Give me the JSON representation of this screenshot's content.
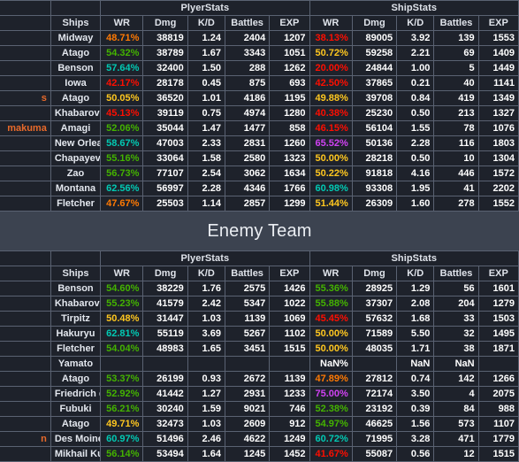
{
  "banner": {
    "enemy_team_title": "Enemy Team"
  },
  "group_headers": {
    "player_stats": "PlyerStats",
    "ship_stats": "ShipStats"
  },
  "columns": {
    "name": "",
    "ships": "Ships",
    "player": {
      "wr": "WR",
      "dmg": "Dmg",
      "kd": "K/D",
      "battles": "Battles",
      "exp": "EXP"
    },
    "ship": {
      "wr": "WR",
      "dmg": "Dmg",
      "kd": "K/D",
      "battles": "Battles",
      "exp": "EXP"
    }
  },
  "colors": {
    "red": "#fe0e00",
    "orange": "#fe7903",
    "yellow": "#ffc71f",
    "green": "#44b300",
    "teal": "#02c9b3",
    "purple": "#d042f3",
    "player_name": "#e96a2a",
    "banner_bg": "#3c4350",
    "table_bg": "#1e222b",
    "page_bg": "#2c313c",
    "grid": "#5a6272"
  },
  "friendly_team": {
    "rows": [
      {
        "name": "",
        "ship": "Midway",
        "p_wr": "48.71%",
        "p_wr_c": "wr-orange",
        "p_dmg": "38819",
        "p_kd": "1.24",
        "p_bat": "2404",
        "p_exp": "1207",
        "s_wr": "38.13%",
        "s_wr_c": "wr-red",
        "s_dmg": "89005",
        "s_kd": "3.92",
        "s_bat": "139",
        "s_exp": "1553"
      },
      {
        "name": "",
        "ship": "Atago",
        "p_wr": "54.32%",
        "p_wr_c": "wr-green",
        "p_dmg": "38789",
        "p_kd": "1.67",
        "p_bat": "3343",
        "p_exp": "1051",
        "s_wr": "50.72%",
        "s_wr_c": "wr-yellow",
        "s_dmg": "59258",
        "s_kd": "2.21",
        "s_bat": "69",
        "s_exp": "1409"
      },
      {
        "name": "",
        "ship": "Benson",
        "p_wr": "57.64%",
        "p_wr_c": "wr-teal",
        "p_dmg": "32400",
        "p_kd": "1.50",
        "p_bat": "288",
        "p_exp": "1262",
        "s_wr": "20.00%",
        "s_wr_c": "wr-red",
        "s_dmg": "24844",
        "s_kd": "1.00",
        "s_bat": "5",
        "s_exp": "1449"
      },
      {
        "name": "",
        "ship": "Iowa",
        "p_wr": "42.17%",
        "p_wr_c": "wr-red",
        "p_dmg": "28178",
        "p_kd": "0.45",
        "p_bat": "875",
        "p_exp": "693",
        "s_wr": "42.50%",
        "s_wr_c": "wr-red",
        "s_dmg": "37865",
        "s_kd": "0.21",
        "s_bat": "40",
        "s_exp": "1141"
      },
      {
        "name": "s",
        "ship": "Atago",
        "p_wr": "50.05%",
        "p_wr_c": "wr-yellow",
        "p_dmg": "36520",
        "p_kd": "1.01",
        "p_bat": "4186",
        "p_exp": "1195",
        "s_wr": "49.88%",
        "s_wr_c": "wr-yellow",
        "s_dmg": "39708",
        "s_kd": "0.84",
        "s_bat": "419",
        "s_exp": "1349"
      },
      {
        "name": "",
        "ship": "Khabarovsk",
        "p_wr": "45.13%",
        "p_wr_c": "wr-red",
        "p_dmg": "39119",
        "p_kd": "0.75",
        "p_bat": "4974",
        "p_exp": "1280",
        "s_wr": "40.38%",
        "s_wr_c": "wr-red",
        "s_dmg": "25230",
        "s_kd": "0.50",
        "s_bat": "213",
        "s_exp": "1327"
      },
      {
        "name": "makuma",
        "ship": "Amagi",
        "p_wr": "52.06%",
        "p_wr_c": "wr-green",
        "p_dmg": "35044",
        "p_kd": "1.47",
        "p_bat": "1477",
        "p_exp": "858",
        "s_wr": "46.15%",
        "s_wr_c": "wr-red",
        "s_dmg": "56104",
        "s_kd": "1.55",
        "s_bat": "78",
        "s_exp": "1076"
      },
      {
        "name": "",
        "ship": "New Orleans",
        "p_wr": "58.67%",
        "p_wr_c": "wr-teal",
        "p_dmg": "47003",
        "p_kd": "2.33",
        "p_bat": "2831",
        "p_exp": "1260",
        "s_wr": "65.52%",
        "s_wr_c": "wr-purple",
        "s_dmg": "50136",
        "s_kd": "2.28",
        "s_bat": "116",
        "s_exp": "1803"
      },
      {
        "name": "",
        "ship": "Chapayev",
        "p_wr": "55.16%",
        "p_wr_c": "wr-green",
        "p_dmg": "33064",
        "p_kd": "1.58",
        "p_bat": "2580",
        "p_exp": "1323",
        "s_wr": "50.00%",
        "s_wr_c": "wr-yellow",
        "s_dmg": "28218",
        "s_kd": "0.50",
        "s_bat": "10",
        "s_exp": "1304"
      },
      {
        "name": "",
        "ship": "Zao",
        "p_wr": "56.73%",
        "p_wr_c": "wr-green",
        "p_dmg": "77107",
        "p_kd": "2.54",
        "p_bat": "3062",
        "p_exp": "1634",
        "s_wr": "50.22%",
        "s_wr_c": "wr-yellow",
        "s_dmg": "91818",
        "s_kd": "4.16",
        "s_bat": "446",
        "s_exp": "1572"
      },
      {
        "name": "",
        "ship": "Montana",
        "p_wr": "62.56%",
        "p_wr_c": "wr-teal",
        "p_dmg": "56997",
        "p_kd": "2.28",
        "p_bat": "4346",
        "p_exp": "1766",
        "s_wr": "60.98%",
        "s_wr_c": "wr-teal",
        "s_dmg": "93308",
        "s_kd": "1.95",
        "s_bat": "41",
        "s_exp": "2202"
      },
      {
        "name": "",
        "ship": "Fletcher",
        "p_wr": "47.67%",
        "p_wr_c": "wr-orange",
        "p_dmg": "25503",
        "p_kd": "1.14",
        "p_bat": "2857",
        "p_exp": "1299",
        "s_wr": "51.44%",
        "s_wr_c": "wr-yellow",
        "s_dmg": "26309",
        "s_kd": "1.60",
        "s_bat": "278",
        "s_exp": "1552"
      }
    ]
  },
  "enemy_team": {
    "rows": [
      {
        "name": "",
        "ship": "Benson",
        "p_wr": "54.60%",
        "p_wr_c": "wr-green",
        "p_dmg": "38229",
        "p_kd": "1.76",
        "p_bat": "2575",
        "p_exp": "1426",
        "s_wr": "55.36%",
        "s_wr_c": "wr-green",
        "s_dmg": "28925",
        "s_kd": "1.29",
        "s_bat": "56",
        "s_exp": "1601"
      },
      {
        "name": "",
        "ship": "Khabarovsk",
        "p_wr": "55.23%",
        "p_wr_c": "wr-green",
        "p_dmg": "41579",
        "p_kd": "2.42",
        "p_bat": "5347",
        "p_exp": "1022",
        "s_wr": "55.88%",
        "s_wr_c": "wr-green",
        "s_dmg": "37307",
        "s_kd": "2.08",
        "s_bat": "204",
        "s_exp": "1279"
      },
      {
        "name": "",
        "ship": "Tirpitz",
        "p_wr": "50.48%",
        "p_wr_c": "wr-yellow",
        "p_dmg": "31447",
        "p_kd": "1.03",
        "p_bat": "1139",
        "p_exp": "1069",
        "s_wr": "45.45%",
        "s_wr_c": "wr-red",
        "s_dmg": "57632",
        "s_kd": "1.68",
        "s_bat": "33",
        "s_exp": "1503"
      },
      {
        "name": "",
        "ship": "Hakuryu",
        "p_wr": "62.81%",
        "p_wr_c": "wr-teal",
        "p_dmg": "55119",
        "p_kd": "3.69",
        "p_bat": "5267",
        "p_exp": "1102",
        "s_wr": "50.00%",
        "s_wr_c": "wr-yellow",
        "s_dmg": "71589",
        "s_kd": "5.50",
        "s_bat": "32",
        "s_exp": "1495"
      },
      {
        "name": "",
        "ship": "Fletcher",
        "p_wr": "54.04%",
        "p_wr_c": "wr-green",
        "p_dmg": "48983",
        "p_kd": "1.65",
        "p_bat": "3451",
        "p_exp": "1515",
        "s_wr": "50.00%",
        "s_wr_c": "wr-yellow",
        "s_dmg": "48035",
        "s_kd": "1.71",
        "s_bat": "38",
        "s_exp": "1871"
      },
      {
        "name": "",
        "ship": "Yamato",
        "p_wr": "",
        "p_wr_c": "wr-nan",
        "p_dmg": "",
        "p_kd": "",
        "p_bat": "",
        "p_exp": "",
        "s_wr": "NaN%",
        "s_wr_c": "wr-nan",
        "s_dmg": "",
        "s_kd": "NaN",
        "s_bat": "NaN",
        "s_exp": ""
      },
      {
        "name": "",
        "ship": "Atago",
        "p_wr": "53.37%",
        "p_wr_c": "wr-green",
        "p_dmg": "26199",
        "p_kd": "0.93",
        "p_bat": "2672",
        "p_exp": "1139",
        "s_wr": "47.89%",
        "s_wr_c": "wr-orange",
        "s_dmg": "27812",
        "s_kd": "0.74",
        "s_bat": "142",
        "s_exp": "1266"
      },
      {
        "name": "",
        "ship": "Friedrich der Große",
        "p_wr": "52.92%",
        "p_wr_c": "wr-green",
        "p_dmg": "41442",
        "p_kd": "1.27",
        "p_bat": "2931",
        "p_exp": "1233",
        "s_wr": "75.00%",
        "s_wr_c": "wr-purple",
        "s_dmg": "72174",
        "s_kd": "3.50",
        "s_bat": "4",
        "s_exp": "2075"
      },
      {
        "name": "",
        "ship": "Fubuki",
        "p_wr": "56.21%",
        "p_wr_c": "wr-green",
        "p_dmg": "30240",
        "p_kd": "1.59",
        "p_bat": "9021",
        "p_exp": "746",
        "s_wr": "52.38%",
        "s_wr_c": "wr-green",
        "s_dmg": "23192",
        "s_kd": "0.39",
        "s_bat": "84",
        "s_exp": "988"
      },
      {
        "name": "",
        "ship": "Atago",
        "p_wr": "49.71%",
        "p_wr_c": "wr-yellow",
        "p_dmg": "32473",
        "p_kd": "1.03",
        "p_bat": "2609",
        "p_exp": "912",
        "s_wr": "54.97%",
        "s_wr_c": "wr-green",
        "s_dmg": "46625",
        "s_kd": "1.56",
        "s_bat": "573",
        "s_exp": "1107"
      },
      {
        "name": "n",
        "ship": "Des Moines",
        "p_wr": "60.97%",
        "p_wr_c": "wr-teal",
        "p_dmg": "51496",
        "p_kd": "2.46",
        "p_bat": "4622",
        "p_exp": "1249",
        "s_wr": "60.72%",
        "s_wr_c": "wr-teal",
        "s_dmg": "71995",
        "s_kd": "3.28",
        "s_bat": "471",
        "s_exp": "1779"
      },
      {
        "name": "",
        "ship": "Mikhail Kutuzov",
        "p_wr": "56.14%",
        "p_wr_c": "wr-green",
        "p_dmg": "53494",
        "p_kd": "1.64",
        "p_bat": "1245",
        "p_exp": "1452",
        "s_wr": "41.67%",
        "s_wr_c": "wr-red",
        "s_dmg": "55087",
        "s_kd": "0.56",
        "s_bat": "12",
        "s_exp": "1515"
      }
    ]
  }
}
